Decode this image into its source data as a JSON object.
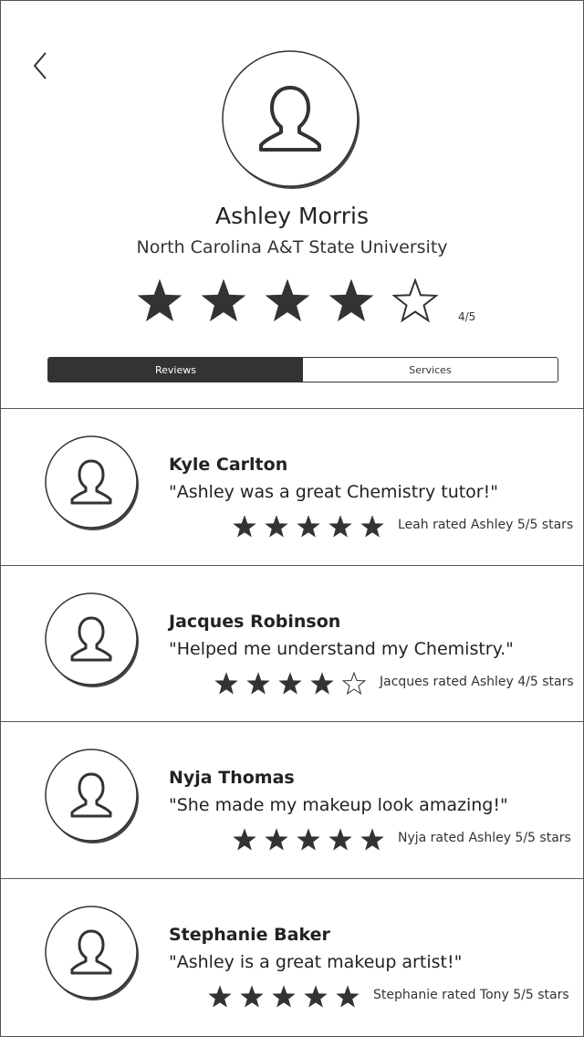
{
  "profile": {
    "name": "Ashley Morris",
    "school": "North Carolina A&T State University",
    "rating_value": 4,
    "rating_max": 5,
    "rating_text": "4/5"
  },
  "tabs": [
    {
      "label": "Reviews",
      "active": true
    },
    {
      "label": "Services",
      "active": false
    }
  ],
  "icons": {
    "back": "chevron-left-icon",
    "avatar": "user-icon",
    "star_filled": "star-filled-icon",
    "star_empty": "star-outline-icon"
  },
  "colors": {
    "accent": "#333333",
    "border": "#555555",
    "background": "#ffffff"
  },
  "reviews": [
    {
      "name": "Kyle Carlton",
      "quote": "\"Ashley was a great Chemistry tutor!\"",
      "stars": 5,
      "rating_text": "Leah rated Ashley 5/5 stars"
    },
    {
      "name": "Jacques Robinson",
      "quote": "\"Helped me understand my Chemistry.\"",
      "stars": 4,
      "rating_text": "Jacques rated Ashley 4/5 stars"
    },
    {
      "name": "Nyja Thomas",
      "quote": "\"She made my makeup look amazing!\"",
      "stars": 5,
      "rating_text": "Nyja rated Ashley 5/5 stars"
    },
    {
      "name": "Stephanie Baker",
      "quote": "\"Ashley is a great makeup artist!\"",
      "stars": 5,
      "rating_text": "Stephanie rated Tony 5/5 stars"
    }
  ]
}
